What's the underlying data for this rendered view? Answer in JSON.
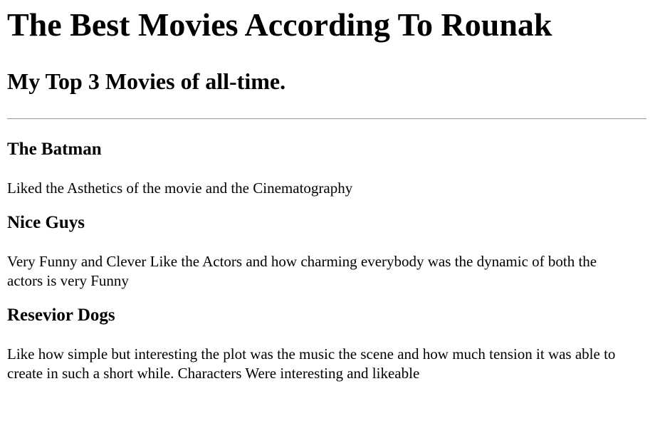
{
  "page": {
    "title": "The Best Movies According To Rounak",
    "subtitle": "My Top 3 Movies of all-time."
  },
  "movies": [
    {
      "title": "The Batman",
      "description": "Liked the Asthetics of the movie and the Cinematography"
    },
    {
      "title": "Nice Guys",
      "description": "Very Funny and Clever Like the Actors and how charming everybody was the dynamic of both the actors is very Funny"
    },
    {
      "title": "Resevior Dogs",
      "description": "Like how simple but interesting the plot was the music the scene and how much tension it was able to create in such a short while. Characters Were interesting and likeable"
    }
  ]
}
